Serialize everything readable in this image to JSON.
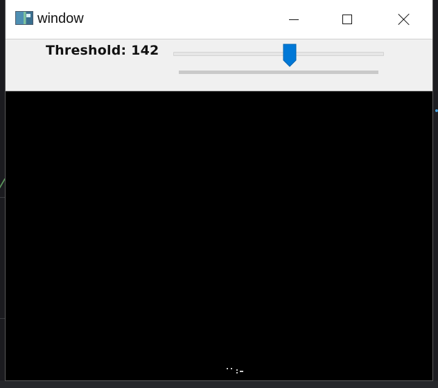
{
  "window": {
    "title": "window",
    "icon": "window-app-icon"
  },
  "titlebar_buttons": {
    "minimize": "minimize-icon",
    "maximize": "maximize-icon",
    "close": "close-icon"
  },
  "trackbar": {
    "label": "Threshold: 142",
    "value": 142,
    "min": 0,
    "max": 255,
    "accent_color": "#0078d7"
  },
  "image": {
    "background_color": "#000000"
  }
}
